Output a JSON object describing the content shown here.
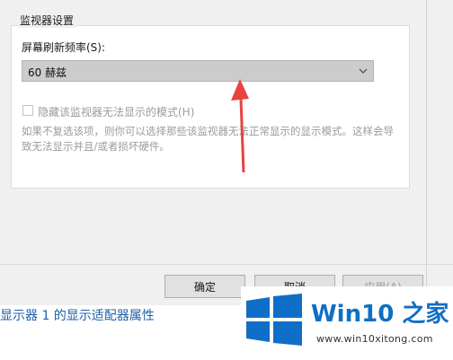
{
  "dialog": {
    "group_title": "监视器设置",
    "refresh_rate_label": "屏幕刷新频率(S):",
    "refresh_rate_value": "60 赫兹",
    "hide_modes_label": "隐藏该监视器无法显示的模式(H)",
    "hide_modes_checked": false,
    "help_text": "如果不复选该项，则你可以选择那些该监视器无法正常显示的显示模式。这样会导致无法显示并且/或者损坏硬件。",
    "buttons": {
      "ok": "确定",
      "cancel": "取消",
      "apply": "应用(A)"
    }
  },
  "background": {
    "link_text": "显示器 1 的显示适配器属性"
  },
  "watermark": {
    "title": "Win10 之家",
    "url": "www.win10xitong.com",
    "logo_icon": "windows-logo-icon"
  },
  "colors": {
    "arrow": "#e8433e",
    "brand_blue": "#0f6fc6",
    "link_blue": "#1e5fa8"
  }
}
